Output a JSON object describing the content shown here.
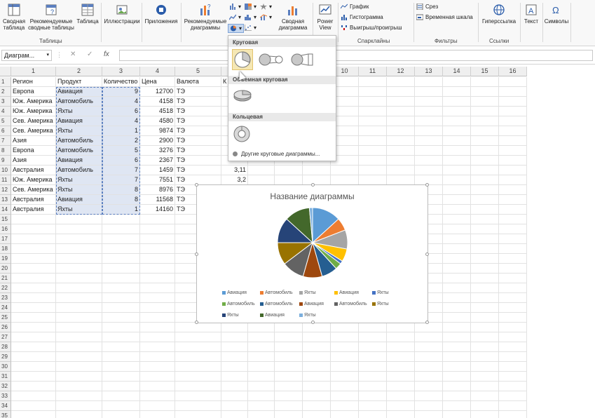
{
  "ribbon": {
    "pivot": "Сводная таблица",
    "rec_pivot": "Рекомендуемые сводные таблицы",
    "table": "Таблица",
    "group_tables": "Таблицы",
    "illustrations": "Иллюстрации",
    "apps": "Приложения",
    "rec_charts": "Рекомендуемые диаграммы",
    "pivot_chart": "Сводная диаграмма",
    "power_view": "Power View",
    "spark_line": "График",
    "spark_column": "Гистограмма",
    "spark_winloss": "Выигрыш/проигрыш",
    "group_sparklines": "Спарклайны",
    "slicer": "Срез",
    "timeline": "Временная шкала",
    "group_filters": "Фильтры",
    "hyperlink": "Гиперссылка",
    "group_links": "Ссылки",
    "text": "Текст",
    "symbols": "Символы"
  },
  "formula_bar": {
    "name_box": "Диаграм...",
    "fx": "fx",
    "cancel": "✕",
    "enter": "✓",
    "formula": ""
  },
  "columns": [
    "1",
    "2",
    "3",
    "4",
    "5",
    "6",
    "7",
    "8",
    "9",
    "10",
    "11",
    "12",
    "13",
    "14",
    "15",
    "16"
  ],
  "headers": [
    "Регион",
    "Продукт",
    "Количество",
    "Цена",
    "Валюта",
    "К"
  ],
  "rows": [
    {
      "region": "Европа",
      "product": "Авиация",
      "qty": "9",
      "price": "12700",
      "cur": "ТЭ"
    },
    {
      "region": "Юж. Америка",
      "product": "Автомобиль",
      "qty": "4",
      "price": "4158",
      "cur": "ТЭ"
    },
    {
      "region": "Юж. Америка",
      "product": "Яхты",
      "qty": "6",
      "price": "4518",
      "cur": "ТЭ"
    },
    {
      "region": "Сев. Америка",
      "product": "Авиация",
      "qty": "4",
      "price": "4580",
      "cur": "ТЭ"
    },
    {
      "region": "Сев. Америка",
      "product": "Яхты",
      "qty": "1",
      "price": "9874",
      "cur": "ТЭ"
    },
    {
      "region": "Азия",
      "product": "Автомобиль",
      "qty": "2",
      "price": "2900",
      "cur": "ТЭ"
    },
    {
      "region": "Европа",
      "product": "Автомобиль",
      "qty": "5",
      "price": "3276",
      "cur": "ТЭ"
    },
    {
      "region": "Азия",
      "product": "Авиация",
      "qty": "6",
      "price": "2367",
      "cur": "ТЭ"
    },
    {
      "region": "Австралия",
      "product": "Автомобиль",
      "qty": "7",
      "price": "1459",
      "cur": "ТЭ"
    },
    {
      "region": "Юж. Америка",
      "product": "Яхты",
      "qty": "7",
      "price": "7551",
      "cur": "ТЭ"
    },
    {
      "region": "Сев. Америка",
      "product": "Яхты",
      "qty": "8",
      "price": "8976",
      "cur": "ТЭ"
    },
    {
      "region": "Австралия",
      "product": "Авиация",
      "qty": "8",
      "price": "11568",
      "cur": "ТЭ"
    },
    {
      "region": "Австралия",
      "product": "Яхты",
      "qty": "1",
      "price": "14160",
      "cur": "ТЭ"
    }
  ],
  "extra_values": [
    "3,11",
    "3,2"
  ],
  "dropdown": {
    "pie_header": "Круговая",
    "pie3d_header": "Объемная круговая",
    "donut_header": "Кольцевая",
    "more": "Другие круговые диаграммы..."
  },
  "chart_data": {
    "type": "pie",
    "title": "Название диаграммы",
    "values": [
      9,
      4,
      6,
      4,
      1,
      2,
      5,
      6,
      7,
      7,
      8,
      8,
      1
    ],
    "series": [
      {
        "name": "Авиация",
        "color": "#5b9bd5"
      },
      {
        "name": "Автомобиль",
        "color": "#ed7d31"
      },
      {
        "name": "Яхты",
        "color": "#a5a5a5"
      },
      {
        "name": "Авиация",
        "color": "#ffc000"
      },
      {
        "name": "Яхты",
        "color": "#4472c4"
      },
      {
        "name": "Автомобиль",
        "color": "#70ad47"
      },
      {
        "name": "Автомобиль",
        "color": "#255e91"
      },
      {
        "name": "Авиация",
        "color": "#9e480e"
      },
      {
        "name": "Автомобиль",
        "color": "#636363"
      },
      {
        "name": "Яхты",
        "color": "#997300"
      },
      {
        "name": "Яхты",
        "color": "#264478"
      },
      {
        "name": "Авиация",
        "color": "#43682b"
      },
      {
        "name": "Яхты",
        "color": "#7cafdd"
      }
    ]
  }
}
